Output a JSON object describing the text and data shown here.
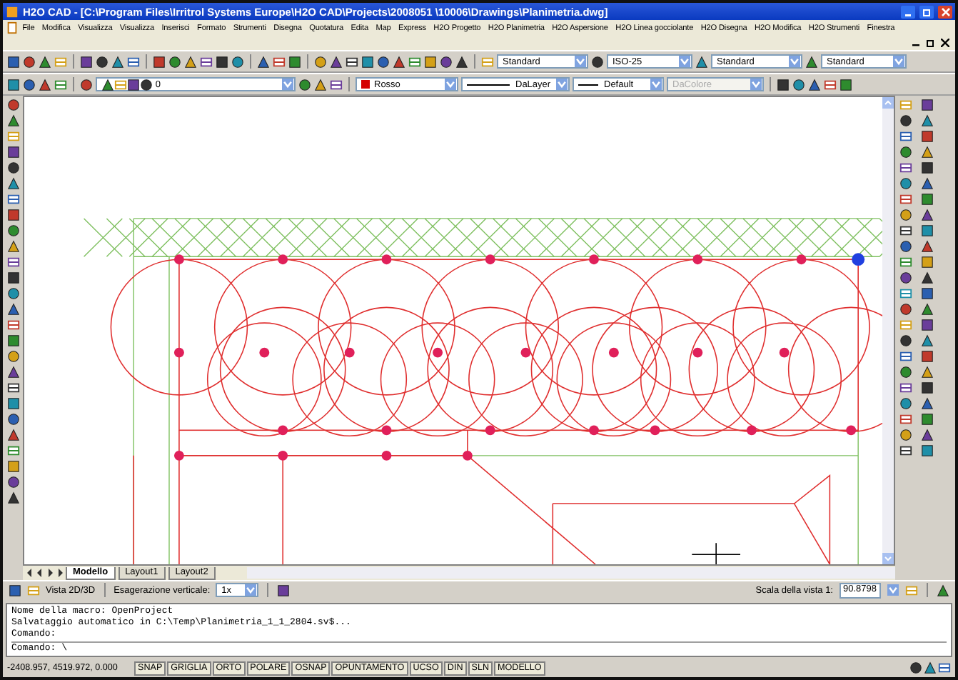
{
  "window": {
    "title": "H2O CAD - [C:\\Program Files\\Irritrol Systems Europe\\H2O CAD\\Projects\\2008051 \\10006\\Drawings\\Planimetria.dwg]"
  },
  "menu": [
    "File",
    "Modifica",
    "Visualizza",
    "Visualizza",
    "Inserisci",
    "Formato",
    "Strumenti",
    "Disegna",
    "Quotatura",
    "Edita",
    "Map",
    "Express",
    "H2O Progetto",
    "H2O Planimetria",
    "H2O Aspersione",
    "H2O Linea gocciolante",
    "H2O Disegna",
    "H2O Modifica",
    "H2O Strumenti",
    "Finestra"
  ],
  "styles_toolbar": {
    "text_style": "Standard",
    "dim_style": "ISO-25",
    "table_style": "Standard",
    "multileader_style": "Standard"
  },
  "properties_toolbar": {
    "layer": "0",
    "color_name": "Rosso",
    "linetype": "DaLayer",
    "lineweight": "Default",
    "plot_style": "DaColore",
    "plot_style_disabled": true
  },
  "tabs": [
    {
      "label": "Modello",
      "selected": true
    },
    {
      "label": "Layout1",
      "selected": false
    },
    {
      "label": "Layout2",
      "selected": false
    }
  ],
  "view_bar": {
    "view_toggle": "Vista 2D/3D",
    "exaggeration_label": "Esagerazione verticale:",
    "exaggeration": "1x",
    "scale_label": "Scala della vista 1:",
    "scale": "90.8798"
  },
  "command": {
    "history": [
      "Nome della macro: OpenProject",
      "Salvataggio automatico in C:\\Temp\\Planimetria_1_1_2804.sv$...",
      "Comando:"
    ],
    "prompt": "Comando: \\"
  },
  "status_bar": {
    "coordinates": "-2408.957, 4519.972, 0.000",
    "toggles": [
      "SNAP",
      "GRIGLIA",
      "ORTO",
      "POLARE",
      "OSNAP",
      "OPUNTAMENTO",
      "UCSO",
      "DIN",
      "SLN",
      "MODELLO"
    ]
  }
}
